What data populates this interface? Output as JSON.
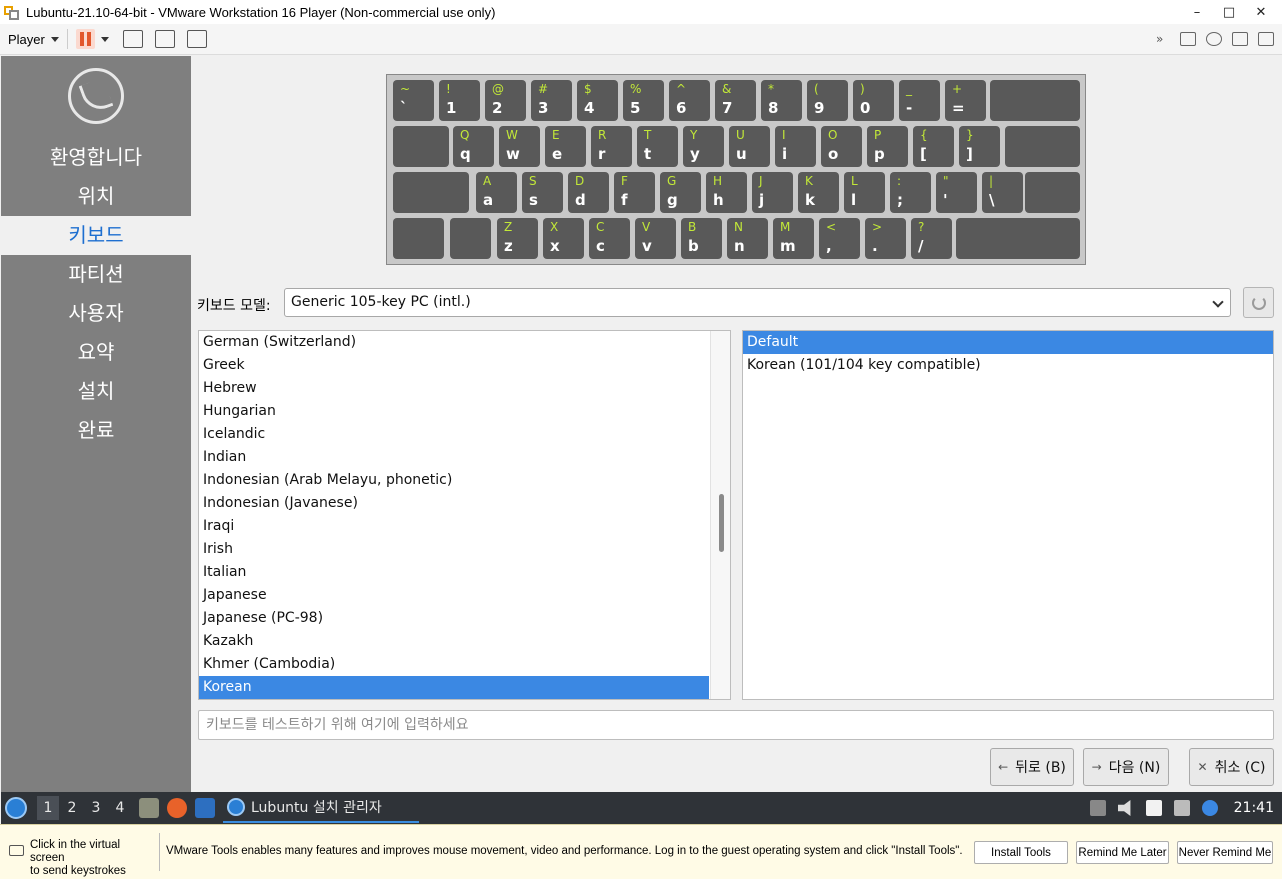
{
  "window": {
    "title": "Lubuntu-21.10-64-bit - VMware Workstation 16 Player (Non-commercial use only)",
    "minimize": "–",
    "maximize": "□",
    "close": "✕"
  },
  "vm_toolbar": {
    "player_menu": "Player"
  },
  "sidebar": {
    "steps": [
      {
        "label": "환영합니다",
        "active": false
      },
      {
        "label": "위치",
        "active": false
      },
      {
        "label": "키보드",
        "active": true
      },
      {
        "label": "파티션",
        "active": false
      },
      {
        "label": "사용자",
        "active": false
      },
      {
        "label": "요약",
        "active": false
      },
      {
        "label": "설치",
        "active": false
      },
      {
        "label": "완료",
        "active": false
      }
    ]
  },
  "keyboard_preview": {
    "rows": [
      [
        {
          "s": "~",
          "b": "`"
        },
        {
          "s": "!",
          "b": "1"
        },
        {
          "s": "@",
          "b": "2"
        },
        {
          "s": "#",
          "b": "3"
        },
        {
          "s": "$",
          "b": "4"
        },
        {
          "s": "%",
          "b": "5"
        },
        {
          "s": "^",
          "b": "6"
        },
        {
          "s": "&",
          "b": "7"
        },
        {
          "s": "*",
          "b": "8"
        },
        {
          "s": "(",
          "b": "9"
        },
        {
          "s": ")",
          "b": "0"
        },
        {
          "s": "_",
          "b": "-"
        },
        {
          "s": "+",
          "b": "="
        }
      ],
      [
        {
          "s": "Q",
          "b": "q"
        },
        {
          "s": "W",
          "b": "w"
        },
        {
          "s": "E",
          "b": "e"
        },
        {
          "s": "R",
          "b": "r"
        },
        {
          "s": "T",
          "b": "t"
        },
        {
          "s": "Y",
          "b": "y"
        },
        {
          "s": "U",
          "b": "u"
        },
        {
          "s": "I",
          "b": "i"
        },
        {
          "s": "O",
          "b": "o"
        },
        {
          "s": "P",
          "b": "p"
        },
        {
          "s": "{",
          "b": "["
        },
        {
          "s": "}",
          "b": "]"
        }
      ],
      [
        {
          "s": "A",
          "b": "a"
        },
        {
          "s": "S",
          "b": "s"
        },
        {
          "s": "D",
          "b": "d"
        },
        {
          "s": "F",
          "b": "f"
        },
        {
          "s": "G",
          "b": "g"
        },
        {
          "s": "H",
          "b": "h"
        },
        {
          "s": "J",
          "b": "j"
        },
        {
          "s": "K",
          "b": "k"
        },
        {
          "s": "L",
          "b": "l"
        },
        {
          "s": ":",
          "b": ";"
        },
        {
          "s": "\"",
          "b": "'"
        },
        {
          "s": "|",
          "b": "\\"
        }
      ],
      [
        {
          "s": "Z",
          "b": "z"
        },
        {
          "s": "X",
          "b": "x"
        },
        {
          "s": "C",
          "b": "c"
        },
        {
          "s": "V",
          "b": "v"
        },
        {
          "s": "B",
          "b": "b"
        },
        {
          "s": "N",
          "b": "n"
        },
        {
          "s": "M",
          "b": "m"
        },
        {
          "s": "<",
          "b": ","
        },
        {
          "s": ">",
          "b": "."
        },
        {
          "s": "?",
          "b": "/"
        }
      ]
    ]
  },
  "keyboard_model": {
    "label": "키보드 모델:",
    "selected": "Generic 105-key PC (intl.)"
  },
  "layouts": {
    "items": [
      "German (Switzerland)",
      "Greek",
      "Hebrew",
      "Hungarian",
      "Icelandic",
      "Indian",
      "Indonesian (Arab Melayu, phonetic)",
      "Indonesian (Javanese)",
      "Iraqi",
      "Irish",
      "Italian",
      "Japanese",
      "Japanese (PC-98)",
      "Kazakh",
      "Khmer (Cambodia)",
      "Korean"
    ],
    "selected": "Korean"
  },
  "variants": {
    "items": [
      "Default",
      "Korean (101/104 key compatible)"
    ],
    "selected": "Default"
  },
  "test_input": {
    "placeholder": "키보드를 테스트하기 위해 여기에 입력하세요",
    "value": ""
  },
  "nav": {
    "back": {
      "icon": "←",
      "label": "뒤로 (B)"
    },
    "next": {
      "icon": "→",
      "label": "다음 (N)"
    },
    "cancel": {
      "icon": "✕",
      "label": "취소 (C)"
    }
  },
  "taskbar": {
    "desktops": [
      "1",
      "2",
      "3",
      "4"
    ],
    "active_desktop": "1",
    "task_title": "Lubuntu 설치 관리자",
    "clock": "21:41"
  },
  "tools_bar": {
    "hint_line1": "Click in the virtual screen",
    "hint_line2": "to send keystrokes",
    "message": "VMware Tools enables many features and improves mouse movement, video and performance. Log in to the guest operating system and click \"Install Tools\".",
    "install": "Install Tools",
    "remind": "Remind Me Later",
    "never": "Never Remind Me"
  }
}
